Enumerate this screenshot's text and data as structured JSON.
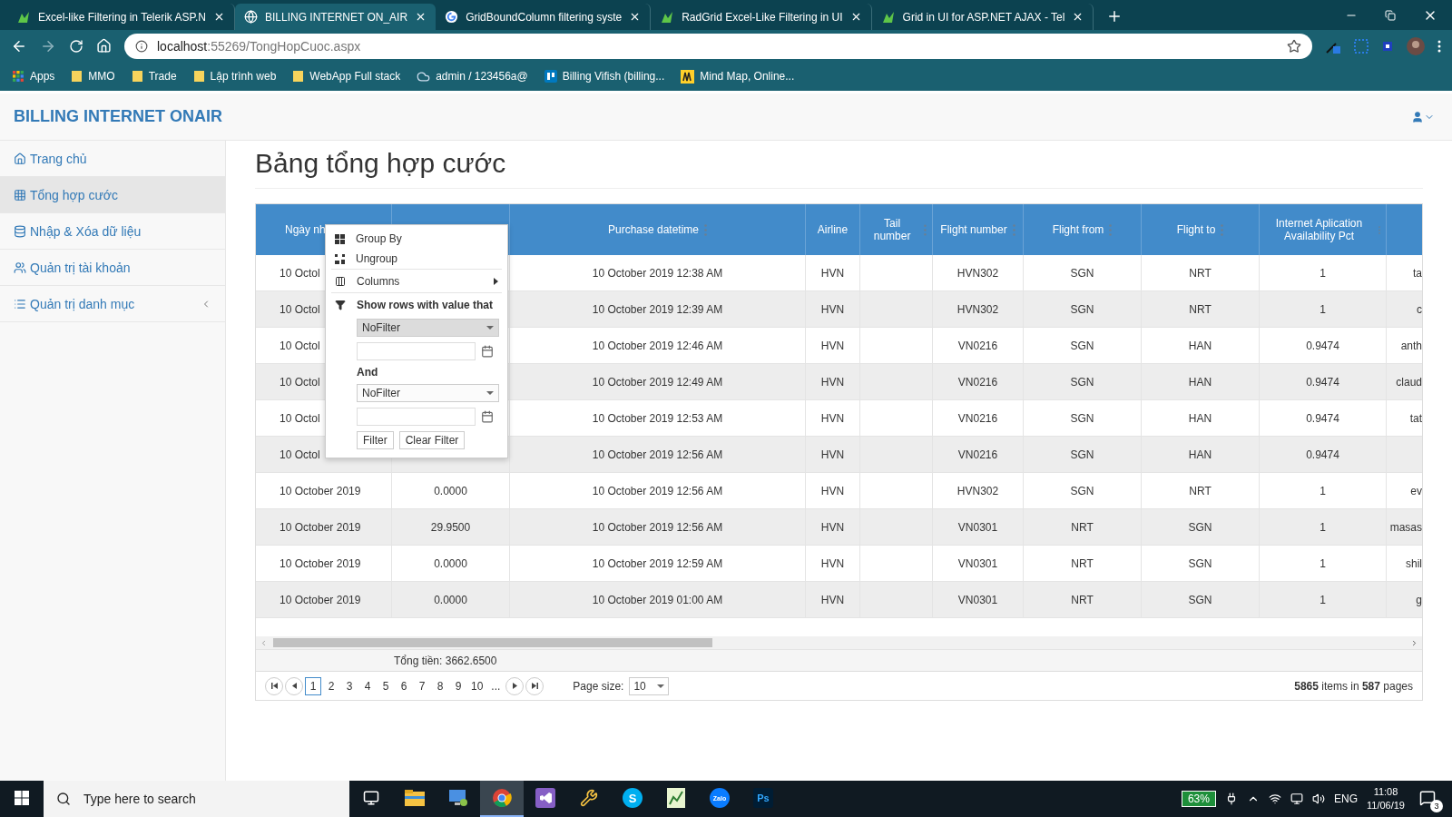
{
  "browser": {
    "tabs": [
      {
        "title": "Excel-like Filtering in Telerik ASP.N",
        "selected": false,
        "kind": "leaf"
      },
      {
        "title": "BILLING INTERNET ON_AIR",
        "selected": true,
        "kind": "globe"
      },
      {
        "title": "GridBoundColumn filtering syste",
        "selected": false,
        "kind": "google"
      },
      {
        "title": "RadGrid Excel-Like Filtering in UI",
        "selected": false,
        "kind": "leaf"
      },
      {
        "title": "Grid in UI for ASP.NET AJAX - Tel",
        "selected": false,
        "kind": "leaf"
      }
    ],
    "address": {
      "host": "localhost",
      "path": ":55269/TongHopCuoc.aspx"
    },
    "bookmarks": [
      {
        "label": "Apps",
        "kind": "apps"
      },
      {
        "label": "MMO",
        "kind": "folder"
      },
      {
        "label": "Trade",
        "kind": "folder"
      },
      {
        "label": "Lập trình web",
        "kind": "folder"
      },
      {
        "label": "WebApp Full stack",
        "kind": "folder"
      },
      {
        "label": "admin / 123456a@",
        "kind": "cloud"
      },
      {
        "label": "Billing Vifish (billing...",
        "kind": "board"
      },
      {
        "label": "Mind Map, Online...",
        "kind": "map"
      }
    ]
  },
  "app": {
    "brand": "BILLING INTERNET ONAIR",
    "sidebar": {
      "items": [
        {
          "label": "Trang chủ",
          "kind": "home",
          "selected": false,
          "has_submenu": false
        },
        {
          "label": "Tổng hợp cước",
          "kind": "grid",
          "selected": true,
          "has_submenu": false
        },
        {
          "label": "Nhập & Xóa dữ liệu",
          "kind": "database",
          "selected": false,
          "has_submenu": false
        },
        {
          "label": "Quản trị tài khoản",
          "kind": "users",
          "selected": false,
          "has_submenu": false
        },
        {
          "label": "Quản trị danh mục",
          "kind": "list",
          "selected": false,
          "has_submenu": true
        }
      ]
    },
    "page_title": "Bảng tổng hợp cước",
    "table": {
      "columns": [
        {
          "label": "Ngày nh"
        },
        {},
        {
          "label": "Purchase datetime"
        },
        {
          "label": "Airline"
        },
        {
          "label": "Tail number"
        },
        {
          "label": "Flight number"
        },
        {
          "label": "Flight from"
        },
        {
          "label": "Flight to"
        },
        {
          "label": "Internet Aplication Availability Pct"
        },
        {}
      ],
      "rows": [
        {
          "cells": [
            "10 Octol",
            null,
            "10 October 2019 12:38 AM",
            "HVN",
            null,
            "HVN302",
            "SGN",
            "NRT",
            "1",
            "ta"
          ]
        },
        {
          "cells": [
            "10 Octol",
            null,
            "10 October 2019 12:39 AM",
            "HVN",
            null,
            "HVN302",
            "SGN",
            "NRT",
            "1",
            "c"
          ]
        },
        {
          "cells": [
            "10 Octol",
            null,
            "10 October 2019 12:46 AM",
            "HVN",
            null,
            "VN0216",
            "SGN",
            "HAN",
            "0.9474",
            "anth"
          ]
        },
        {
          "cells": [
            "10 Octol",
            null,
            "10 October 2019 12:49 AM",
            "HVN",
            null,
            "VN0216",
            "SGN",
            "HAN",
            "0.9474",
            "claud"
          ]
        },
        {
          "cells": [
            "10 Octol",
            null,
            "10 October 2019 12:53 AM",
            "HVN",
            null,
            "VN0216",
            "SGN",
            "HAN",
            "0.9474",
            "tat"
          ]
        },
        {
          "cells": [
            "10 Octol",
            null,
            "10 October 2019 12:56 AM",
            "HVN",
            null,
            "VN0216",
            "SGN",
            "HAN",
            "0.9474",
            null
          ]
        },
        {
          "cells": [
            "10 October 2019",
            "0.0000",
            "10 October 2019 12:56 AM",
            "HVN",
            null,
            "HVN302",
            "SGN",
            "NRT",
            "1",
            "ev"
          ]
        },
        {
          "cells": [
            "10 October 2019",
            "29.9500",
            "10 October 2019 12:56 AM",
            "HVN",
            null,
            "VN0301",
            "NRT",
            "SGN",
            "1",
            "masas"
          ]
        },
        {
          "cells": [
            "10 October 2019",
            "0.0000",
            "10 October 2019 12:59 AM",
            "HVN",
            null,
            "VN0301",
            "NRT",
            "SGN",
            "1",
            "shil"
          ]
        },
        {
          "cells": [
            "10 October 2019",
            "0.0000",
            "10 October 2019 01:00 AM",
            "HVN",
            null,
            "VN0301",
            "NRT",
            "SGN",
            "1",
            "g"
          ]
        }
      ],
      "total": "Tổng tiền: 3662.6500",
      "pager": {
        "pages": [
          {
            "label": "1",
            "selected": true
          },
          {
            "label": "2",
            "selected": false
          },
          {
            "label": "3",
            "selected": false
          },
          {
            "label": "4",
            "selected": false
          },
          {
            "label": "5",
            "selected": false
          },
          {
            "label": "6",
            "selected": false
          },
          {
            "label": "7",
            "selected": false
          },
          {
            "label": "8",
            "selected": false
          },
          {
            "label": "9",
            "selected": false
          },
          {
            "label": "10",
            "selected": false
          },
          {
            "label": "...",
            "selected": false
          }
        ],
        "page_size_label": "Page size:",
        "page_size": "10",
        "summary": "**5865** items in **587** pages"
      }
    },
    "column_menu": {
      "items": [
        {
          "kind": "group",
          "label": "Group By"
        },
        {
          "kind": "ungroup",
          "label": "Ungroup"
        },
        {
          "kind": "columns",
          "label": "Columns"
        },
        {
          "kind": "heading",
          "label": "Show rows with value that"
        },
        {
          "kind": "select",
          "value": "NoFilter",
          "highlighted": true
        },
        {
          "kind": "date"
        },
        {
          "kind": "label",
          "label": "And"
        },
        {
          "kind": "select",
          "value": "NoFilter",
          "highlighted": false
        },
        {
          "kind": "date"
        },
        {
          "kind": "buttons",
          "labels": [
            "Filter",
            "Clear Filter"
          ]
        }
      ]
    }
  },
  "taskbar": {
    "search_placeholder": "Type here to search",
    "apps": [
      {
        "kind": "taskview",
        "active": false
      },
      {
        "kind": "explorer",
        "active": false
      },
      {
        "kind": "remote",
        "active": false
      },
      {
        "kind": "chrome",
        "active": true
      },
      {
        "kind": "vs",
        "active": false
      },
      {
        "kind": "tools",
        "active": false
      },
      {
        "kind": "skype",
        "label": "S",
        "active": false
      },
      {
        "kind": "sheet",
        "active": false
      },
      {
        "kind": "zalo",
        "label": "Zalo",
        "active": false
      },
      {
        "kind": "ps",
        "label": "Ps",
        "active": false
      }
    ],
    "battery": "63%",
    "language": "ENG",
    "time": "11:08",
    "date": "11/06/19",
    "notifications": "3"
  }
}
